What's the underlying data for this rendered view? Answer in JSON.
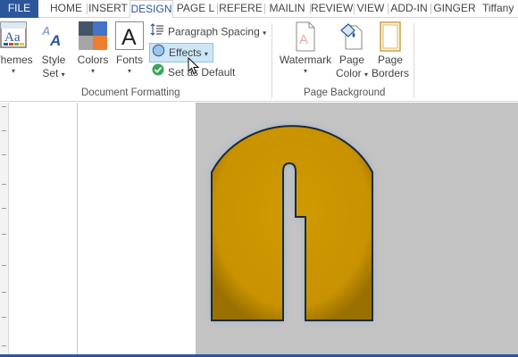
{
  "tabs": [
    {
      "label": "FILE"
    },
    {
      "label": "HOME"
    },
    {
      "label": "INSERT"
    },
    {
      "label": "DESIGN"
    },
    {
      "label": "PAGE L"
    },
    {
      "label": "REFERE"
    },
    {
      "label": "MAILIN"
    },
    {
      "label": "REVIEW"
    },
    {
      "label": "VIEW"
    },
    {
      "label": "ADD-IN"
    },
    {
      "label": "GINGER"
    }
  ],
  "active_tab": "DESIGN",
  "user": "Tiffany",
  "document_formatting": {
    "group_label": "Document Formatting",
    "themes_label": "Themes",
    "style_set_label": "Style Set",
    "style_set_line1": "Style",
    "style_set_line2": "Set",
    "colors_label": "Colors",
    "fonts_label": "Fonts",
    "paragraph_spacing_label": "Paragraph Spacing",
    "effects_label": "Effects",
    "set_as_default_label": "Set as Default"
  },
  "page_background": {
    "group_label": "Page Background",
    "watermark_label": "Watermark",
    "page_color_line1": "Page",
    "page_color_line2": "Color",
    "page_borders_line1": "Page",
    "page_borders_line2": "Borders"
  },
  "document": {
    "glyph": "A",
    "glyph_fill": "#c99200",
    "glyph_glow": "#6b9fd6",
    "page_background_color": "#c3c3c3"
  },
  "colors": {
    "accent": "#2b579a",
    "highlight": "#cde6f7"
  }
}
